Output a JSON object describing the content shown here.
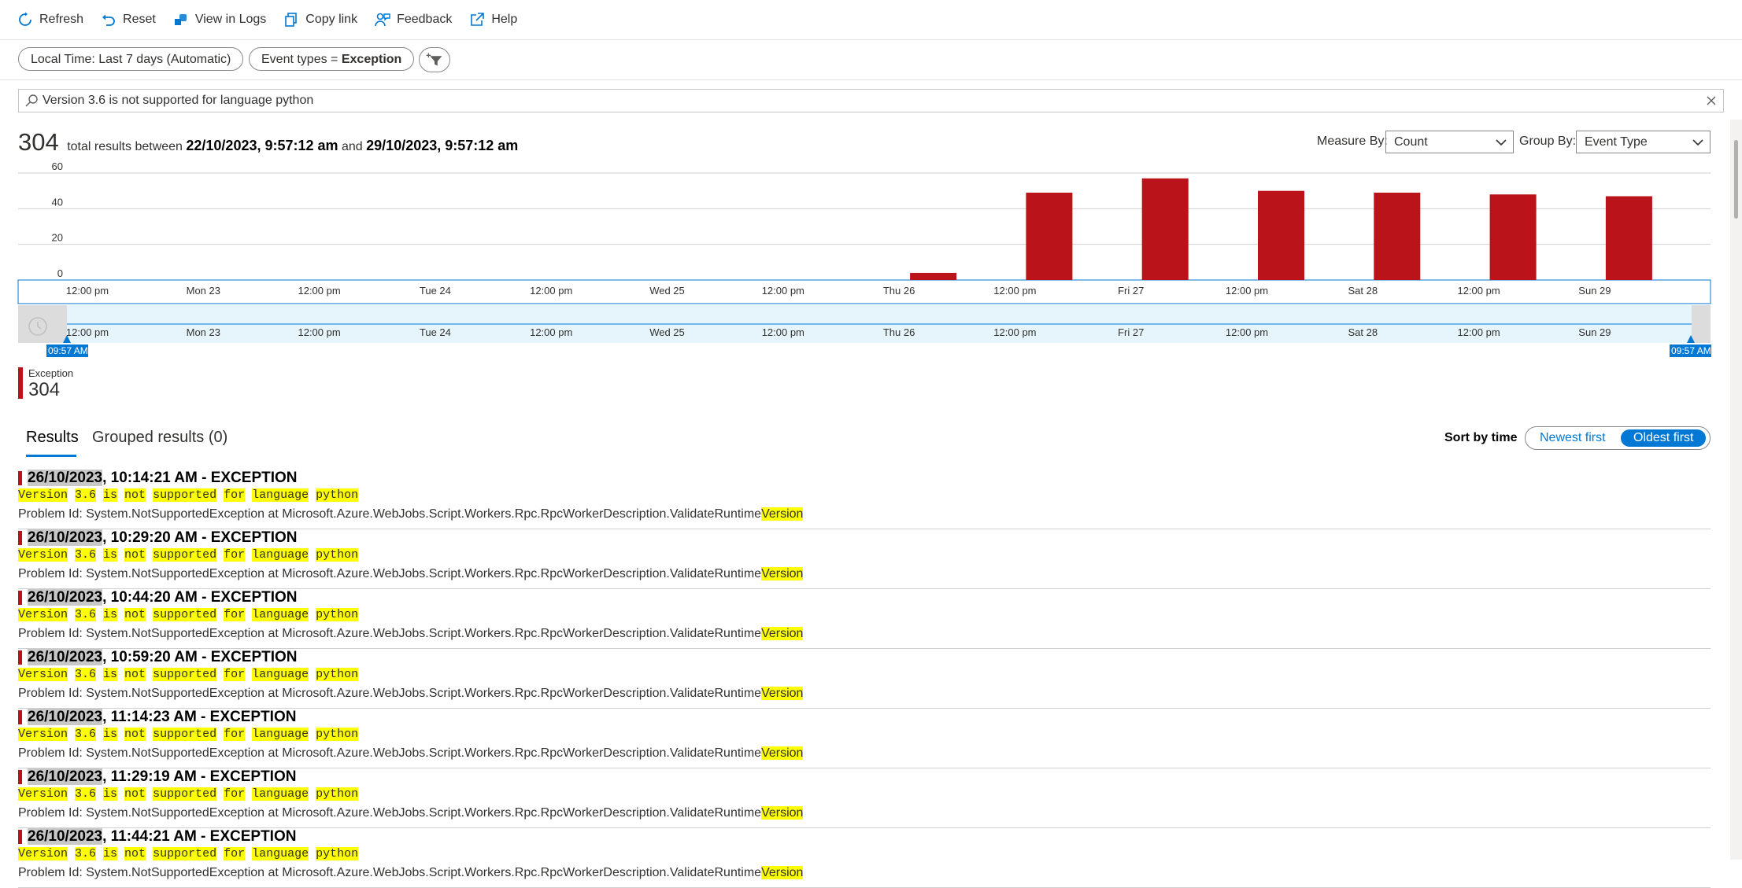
{
  "toolbar": {
    "items": [
      {
        "label": "Refresh",
        "icon": "refresh-icon"
      },
      {
        "label": "Reset",
        "icon": "undo-icon"
      },
      {
        "label": "View in Logs",
        "icon": "logs-icon"
      },
      {
        "label": "Copy link",
        "icon": "copy-icon"
      },
      {
        "label": "Feedback",
        "icon": "feedback-icon"
      },
      {
        "label": "Help",
        "icon": "external-link-icon"
      }
    ]
  },
  "filters": {
    "time": "Local Time: Last 7 days (Automatic)",
    "event_types_prefix": "Event types = ",
    "event_types_value": "Exception",
    "add_filter_icon": "add-filter-icon"
  },
  "search": {
    "value": "Version 3.6 is not supported for language python"
  },
  "summary": {
    "count": "304",
    "text_between": "total results between",
    "start": "22/10/2023, 9:57:12 am",
    "and": "and",
    "end": "29/10/2023, 9:57:12 am"
  },
  "measure_by": {
    "label": "Measure By:",
    "value": "Count"
  },
  "group_by": {
    "label": "Group By:",
    "value": "Event Type"
  },
  "chart_data": {
    "type": "bar",
    "y_ticks": [
      "60",
      "40",
      "20",
      "0"
    ],
    "ylim": [
      0,
      60
    ],
    "x_ticks": [
      "12:00 pm",
      "Mon 23",
      "12:00 pm",
      "Tue 24",
      "12:00 pm",
      "Wed 25",
      "12:00 pm",
      "Thu 26",
      "12:00 pm",
      "Fri 27",
      "12:00 pm",
      "Sat 28",
      "12:00 pm",
      "Sun 29"
    ],
    "series": [
      {
        "name": "Exception",
        "color": "#ba141a",
        "values": [
          0,
          0,
          0,
          0,
          0,
          0,
          0,
          4,
          49,
          57,
          50,
          49,
          48,
          47
        ]
      }
    ],
    "brush_start_label": "09:57 AM",
    "brush_end_label": "09:57 AM"
  },
  "legend": {
    "name": "Exception",
    "value": "304",
    "color": "#ba141a"
  },
  "tabs": {
    "results": "Results",
    "grouped": "Grouped results (0)"
  },
  "sort": {
    "label": "Sort by time",
    "newest": "Newest first",
    "oldest": "Oldest first"
  },
  "results": [
    {
      "date": "26/10/2023",
      "rest": ", 10:14:21 AM - EXCEPTION"
    },
    {
      "date": "26/10/2023",
      "rest": ", 10:29:20 AM - EXCEPTION"
    },
    {
      "date": "26/10/2023",
      "rest": ", 10:44:20 AM - EXCEPTION"
    },
    {
      "date": "26/10/2023",
      "rest": ", 10:59:20 AM - EXCEPTION"
    },
    {
      "date": "26/10/2023",
      "rest": ", 11:14:23 AM - EXCEPTION"
    },
    {
      "date": "26/10/2023",
      "rest": ", 11:29:19 AM - EXCEPTION"
    },
    {
      "date": "26/10/2023",
      "rest": ", 11:44:21 AM - EXCEPTION"
    }
  ],
  "result_message_words": [
    "Version",
    "3.6",
    "is",
    "not",
    "supported",
    "for",
    "language",
    "python"
  ],
  "result_problem_prefix": "Problem Id: System.NotSupportedException at Microsoft.Azure.WebJobs.Script.Workers.Rpc.RpcWorkerDescription.ValidateRuntime",
  "result_problem_highlight": "Version"
}
